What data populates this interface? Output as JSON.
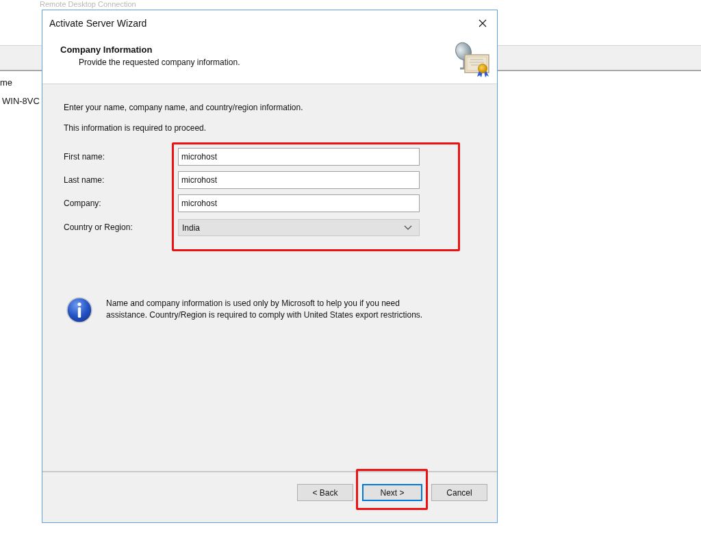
{
  "background_window": {
    "title": "Remote Desktop Connection",
    "list_header": "me",
    "list_items": [
      "WIN-8VC"
    ]
  },
  "dialog": {
    "title": "Activate Server Wizard",
    "header": {
      "title": "Company Information",
      "subtitle": "Provide the requested company information."
    },
    "intro": [
      "Enter your name, company name, and country/region information.",
      "This information is required to proceed."
    ],
    "form_highlighted": true,
    "fields": [
      {
        "kind": "text",
        "label": "First name:",
        "value": "microhost"
      },
      {
        "kind": "text",
        "label": "Last name:",
        "value": "microhost"
      },
      {
        "kind": "text",
        "label": "Company:",
        "value": "microhost"
      },
      {
        "kind": "dropdown",
        "label": "Country or Region:",
        "value": "India"
      }
    ],
    "info": "Name and company information is used only by Microsoft to help you if you need assistance. Country/Region is required to comply with United States export restrictions.",
    "buttons": [
      {
        "label": "< Back",
        "focused": false,
        "highlighted": false
      },
      {
        "label": "Next >",
        "focused": true,
        "highlighted": true
      },
      {
        "label": "Cancel",
        "focused": false,
        "highlighted": false
      }
    ]
  }
}
